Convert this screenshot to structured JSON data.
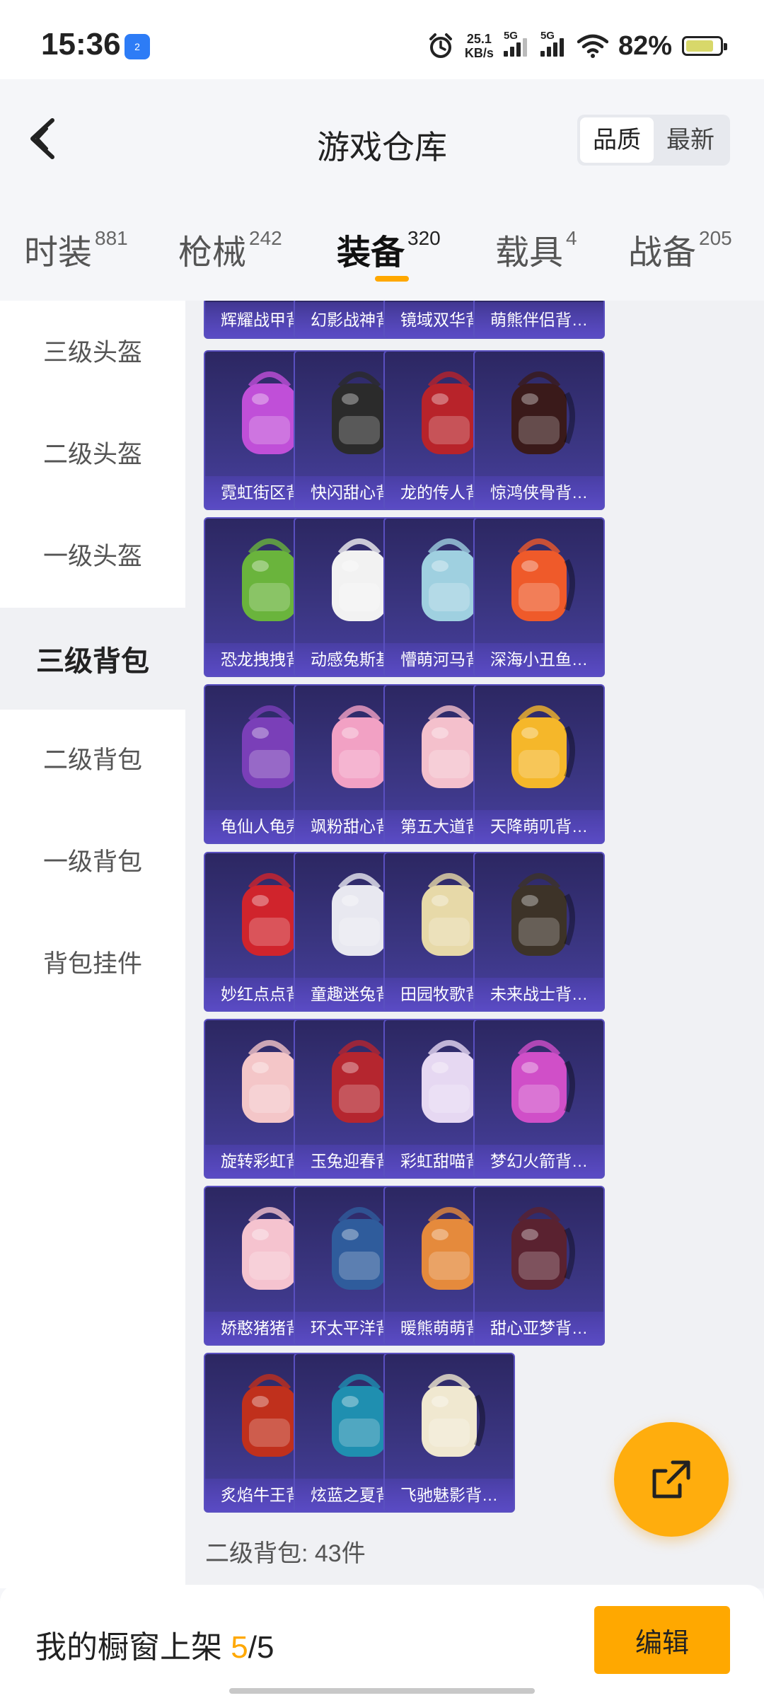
{
  "status_bar": {
    "time": "15:36",
    "notification_badge": "2",
    "net_speed_value": "25.1",
    "net_speed_unit": "KB/s",
    "signal1_label": "5G",
    "signal2_label": "5G",
    "battery": "82%",
    "battery_level": 0.82
  },
  "header": {
    "title": "游戏仓库",
    "sort_options": [
      "品质",
      "最新"
    ],
    "active_sort": "品质"
  },
  "category_tabs": [
    {
      "label": "时装",
      "count": "881"
    },
    {
      "label": "枪械",
      "count": "242"
    },
    {
      "label": "装备",
      "count": "320",
      "active": true
    },
    {
      "label": "载具",
      "count": "4"
    },
    {
      "label": "战备",
      "count": "205"
    }
  ],
  "sidebar": {
    "items": [
      "三级头盔",
      "二级头盔",
      "一级头盔",
      "三级背包",
      "二级背包",
      "一级背包",
      "背包挂件"
    ],
    "active": "三级背包"
  },
  "top_partial_items": [
    "辉耀战甲背…",
    "幻影战神背…",
    "镜域双华背…",
    "萌熊伴侣背…"
  ],
  "items": [
    {
      "label": "霓虹街区背…",
      "icon": "neon-backpack-icon",
      "color": "#c04fd8"
    },
    {
      "label": "快闪甜心背…",
      "icon": "heart-backpack-icon",
      "color": "#2b2b2b"
    },
    {
      "label": "龙的传人背…",
      "icon": "dragon-heir-backpack-icon",
      "color": "#b8232a"
    },
    {
      "label": "惊鸿侠骨背…",
      "icon": "knight-backpack-icon",
      "color": "#3a1a1a"
    },
    {
      "label": "恐龙拽拽背…",
      "icon": "dinosaur-backpack-icon",
      "color": "#6ab43c"
    },
    {
      "label": "动感兔斯基…",
      "icon": "bunny-backpack-icon",
      "color": "#f2f2f2"
    },
    {
      "label": "懵萌河马背…",
      "icon": "hippo-backpack-icon",
      "color": "#9fd0e0"
    },
    {
      "label": "深海小丑鱼…",
      "icon": "clownfish-backpack-icon",
      "color": "#ef5a2a"
    },
    {
      "label": "龟仙人龟壳…",
      "icon": "turtle-shell-backpack-icon",
      "color": "#7a3fb8"
    },
    {
      "label": "飒粉甜心背…",
      "icon": "pink-sweetheart-backpack-icon",
      "color": "#f2a1c4"
    },
    {
      "label": "第五大道背…",
      "icon": "fifth-avenue-backpack-icon",
      "color": "#f4c0cc"
    },
    {
      "label": "天降萌叽背…",
      "icon": "yellow-backpack-icon",
      "color": "#f5b72a"
    },
    {
      "label": "妙红点点背…",
      "icon": "ladybug-backpack-icon",
      "color": "#d0242c"
    },
    {
      "label": "童趣迷兔背…",
      "icon": "checkered-bunny-backpack-icon",
      "color": "#e8e8f0"
    },
    {
      "label": "田园牧歌背…",
      "icon": "picnic-basket-backpack-icon",
      "color": "#e7d9a8"
    },
    {
      "label": "未来战士背…",
      "icon": "future-warrior-backpack-icon",
      "color": "#3d3328"
    },
    {
      "label": "旋转彩虹背…",
      "icon": "rainbow-carousel-backpack-icon",
      "color": "#f4c6c8"
    },
    {
      "label": "玉兔迎春背…",
      "icon": "jade-rabbit-backpack-icon",
      "color": "#b5262f"
    },
    {
      "label": "彩虹甜喵背…",
      "icon": "rainbow-cat-backpack-icon",
      "color": "#e6d8f2"
    },
    {
      "label": "梦幻火箭背…",
      "icon": "rocket-backpack-icon",
      "color": "#d04fc8"
    },
    {
      "label": "娇憨猪猪背…",
      "icon": "piggy-backpack-icon",
      "color": "#f5c3cf"
    },
    {
      "label": "环太平洋背…",
      "icon": "pacific-rim-backpack-icon",
      "color": "#2f5c9c"
    },
    {
      "label": "暖熊萌萌背…",
      "icon": "bear-backpack-icon",
      "color": "#e58a3c"
    },
    {
      "label": "甜心亚梦背…",
      "icon": "dream-backpack-icon",
      "color": "#5a2230"
    },
    {
      "label": "炙焰牛王背…",
      "icon": "flame-bull-backpack-icon",
      "color": "#c0301c"
    },
    {
      "label": "炫蓝之夏背…",
      "icon": "blue-summer-backpack-icon",
      "color": "#1f8fb0"
    },
    {
      "label": "飞驰魅影背…",
      "icon": "racing-phantom-backpack-icon",
      "color": "#f0e8d0"
    }
  ],
  "count_text": "二级背包: 43件",
  "bottom_bar": {
    "shelf_prefix": "我的橱窗上架 ",
    "shelf_current": "5",
    "shelf_sep": "/",
    "shelf_total": "5",
    "edit_label": "编辑"
  }
}
